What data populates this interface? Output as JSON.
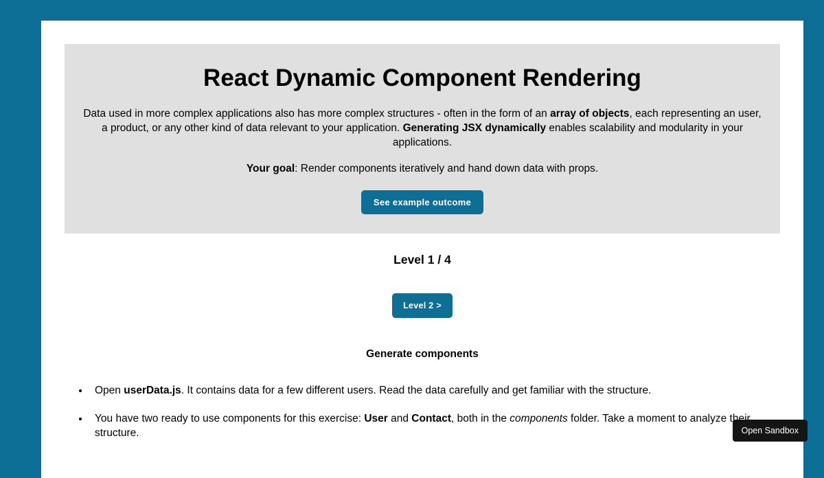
{
  "header": {
    "title": "React Dynamic Component Rendering",
    "intro_pre": "Data used in more complex applications also has more complex structures - often in the form of an ",
    "intro_bold1": "array of objects",
    "intro_mid": ", each representing an user, a product, or any other kind of data relevant to your application. ",
    "intro_bold2": "Generating JSX dynamically",
    "intro_post": " enables scalability and modularity in your applications.",
    "goal_label": "Your goal",
    "goal_text": ": Render components iteratively and hand down data with props.",
    "example_button": "See example outcome"
  },
  "level": {
    "indicator": "Level 1 / 4",
    "next_button": "Level 2 >"
  },
  "content": {
    "section_title": "Generate components",
    "instructions": {
      "item1_pre": "Open ",
      "item1_bold": "userData.js",
      "item1_post": ". It contains data for a few different users. Read the data carefully and get familiar with the structure.",
      "item2_pre": "You have two ready to use components for this exercise: ",
      "item2_bold1": "User",
      "item2_mid1": " and ",
      "item2_bold2": "Contact",
      "item2_mid2": ", both in the ",
      "item2_em": "components",
      "item2_post": " folder. Take a moment to analyze their structure."
    }
  },
  "sandbox": {
    "button": "Open Sandbox"
  }
}
